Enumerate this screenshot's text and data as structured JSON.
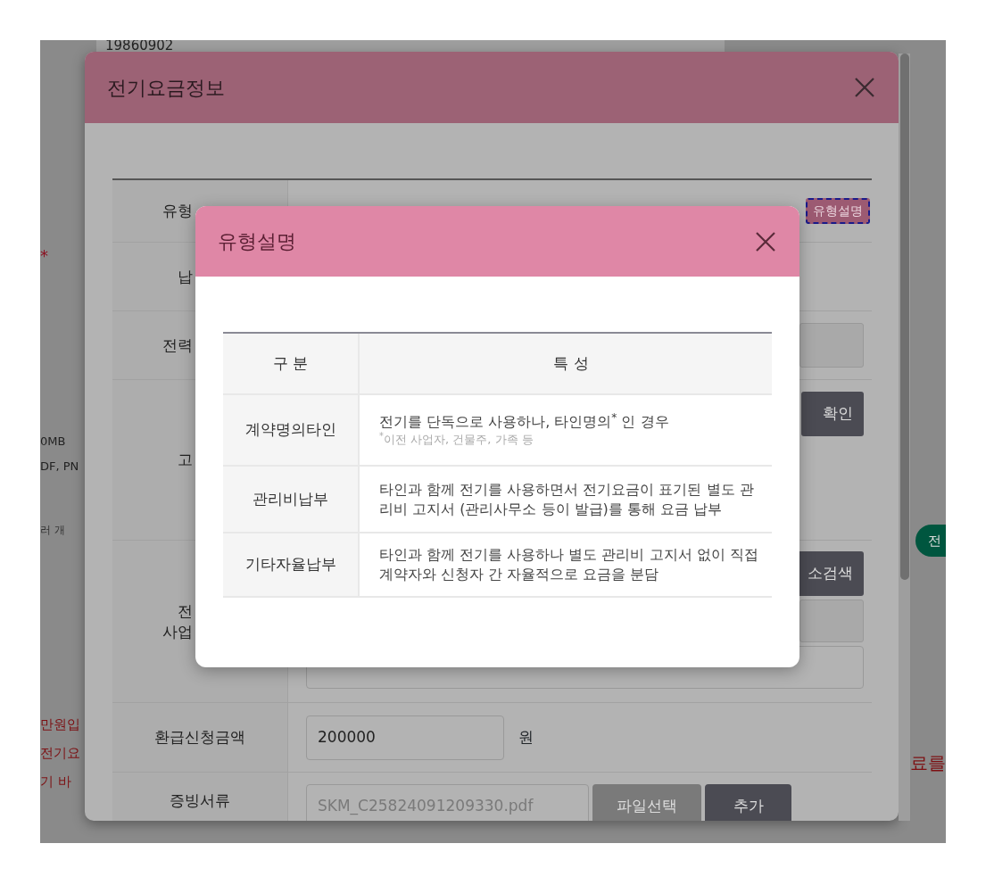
{
  "background": {
    "top_field": "19860902",
    "fragments": [
      {
        "kind": "mark",
        "text": "*"
      },
      {
        "kind": "note",
        "text": "0MB"
      },
      {
        "kind": "note",
        "text": "DF, PN"
      },
      {
        "kind": "small",
        "text": "러 개"
      },
      {
        "kind": "alert",
        "text": "만원입"
      },
      {
        "kind": "alert_large",
        "text": "전기요"
      },
      {
        "kind": "alert_large",
        "text": "기 바"
      },
      {
        "kind": "alert_right",
        "text": "료를"
      }
    ],
    "pill_button": "전"
  },
  "outer_modal": {
    "title": "전기요금정보",
    "rows": [
      {
        "label": [
          "유형"
        ],
        "kind": "help",
        "button": "유형설명",
        "focused": true
      },
      {
        "label": [
          "납"
        ],
        "kind": "empty"
      },
      {
        "label": [
          "전력"
        ],
        "kind": "input_stub"
      },
      {
        "label": [
          "고"
        ],
        "kind": "button_stub",
        "button": "확인"
      },
      {
        "label": [
          "전",
          "사업"
        ],
        "kind": "address",
        "button": "소검색"
      },
      {
        "label": [
          "환급신청금액"
        ],
        "kind": "amount",
        "value": "200000",
        "unit": "원"
      },
      {
        "label": [
          "증빙서류"
        ],
        "kind": "file",
        "value": "SKM_C25824091209330.pdf",
        "buttons": [
          "파일선택",
          "추가"
        ]
      }
    ]
  },
  "inner_modal": {
    "title": "유형설명",
    "columns": [
      "구 분",
      "특 성"
    ],
    "rows": [
      {
        "type": "계약명의타인",
        "description": "전기를 단독으로 사용하나, 타인명의$^{*}$ 인 경우",
        "note": "$^{*}$이전 사업자, 건물주, 가족 등"
      },
      {
        "type": "관리비납부",
        "description": "타인과 함께 전기를 사용하면서 전기요금이 표기된 별도 관리비 고지서 (관리사무소 등이 발급)를 통해 요금 납부"
      },
      {
        "type": "기타자율납부",
        "description": "타인과 함께 전기를 사용하나 별도 관리비 고지서 없이 직접 계약자와 신청자 간 자율적으로 요금을 분담"
      }
    ]
  }
}
